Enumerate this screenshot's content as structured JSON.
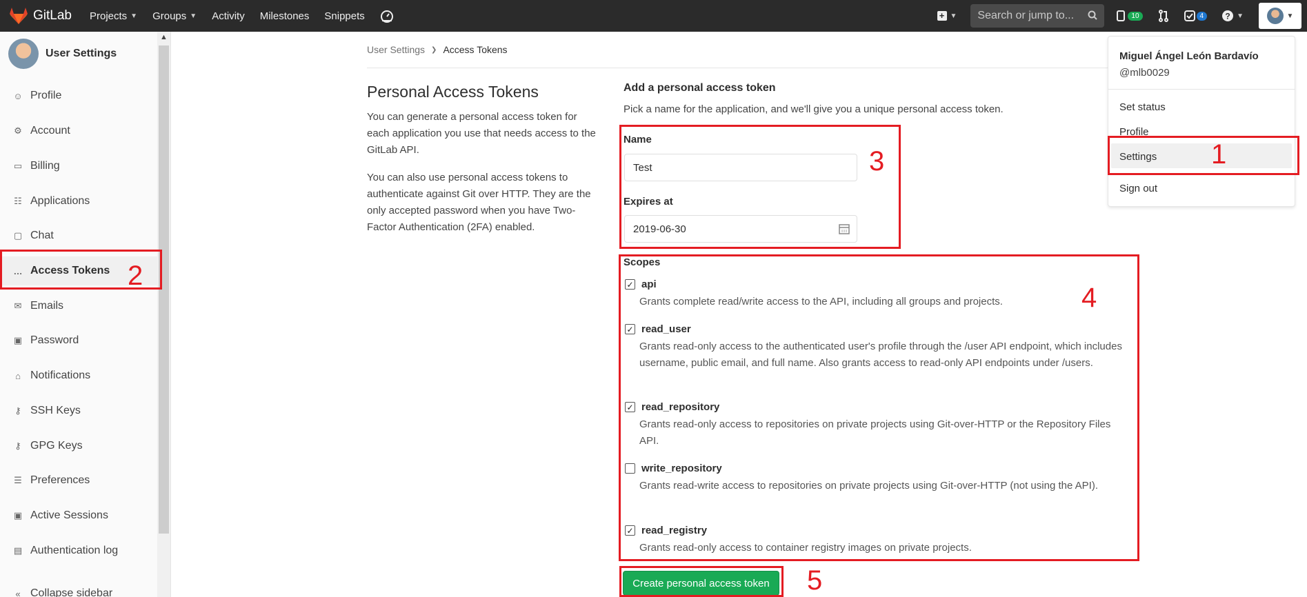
{
  "navbar": {
    "brand": "GitLab",
    "links": [
      {
        "label": "Projects",
        "caret": true
      },
      {
        "label": "Groups",
        "caret": true
      },
      {
        "label": "Activity",
        "caret": false
      },
      {
        "label": "Milestones",
        "caret": false
      },
      {
        "label": "Snippets",
        "caret": false
      }
    ],
    "search_placeholder": "Search or jump to...",
    "issues_count": "10",
    "todos_count": "4"
  },
  "sidebar": {
    "title": "User Settings",
    "items": [
      {
        "label": "Profile",
        "icon": "user-circle-icon",
        "glyph": "☺"
      },
      {
        "label": "Account",
        "icon": "account-icon",
        "glyph": "⚙"
      },
      {
        "label": "Billing",
        "icon": "credit-card-icon",
        "glyph": "▭"
      },
      {
        "label": "Applications",
        "icon": "apps-grid-icon",
        "glyph": "☷"
      },
      {
        "label": "Chat",
        "icon": "comment-icon",
        "glyph": "▢"
      },
      {
        "label": "Access Tokens",
        "icon": "token-icon",
        "glyph": "…",
        "active": true
      },
      {
        "label": "Emails",
        "icon": "envelope-icon",
        "glyph": "✉"
      },
      {
        "label": "Password",
        "icon": "lock-icon",
        "glyph": "▣"
      },
      {
        "label": "Notifications",
        "icon": "bell-icon",
        "glyph": "⌂"
      },
      {
        "label": "SSH Keys",
        "icon": "key-icon",
        "glyph": "⚷"
      },
      {
        "label": "GPG Keys",
        "icon": "gpg-key-icon",
        "glyph": "⚷"
      },
      {
        "label": "Preferences",
        "icon": "sliders-icon",
        "glyph": "☰"
      },
      {
        "label": "Active Sessions",
        "icon": "monitor-icon",
        "glyph": "▣"
      },
      {
        "label": "Authentication log",
        "icon": "list-icon",
        "glyph": "▤"
      },
      {
        "label": "Collapse sidebar",
        "icon": "collapse-icon",
        "glyph": "«"
      }
    ]
  },
  "breadcrumb": {
    "parent": "User Settings",
    "current": "Access Tokens"
  },
  "intro": {
    "title": "Personal Access Tokens",
    "para1": "You can generate a personal access token for each application you use that needs access to the GitLab API.",
    "para2": "You can also use personal access tokens to authenticate against Git over HTTP. They are the only accepted password when you have Two-Factor Authentication (2FA) enabled."
  },
  "form": {
    "title": "Add a personal access token",
    "subtitle": "Pick a name for the application, and we'll give you a unique personal access token.",
    "name_label": "Name",
    "name_value": "Test",
    "expires_label": "Expires at",
    "expires_value": "2019-06-30",
    "scopes_label": "Scopes",
    "scopes": [
      {
        "name": "api",
        "checked": true,
        "desc": "Grants complete read/write access to the API, including all groups and projects."
      },
      {
        "name": "read_user",
        "checked": true,
        "desc": "Grants read-only access to the authenticated user's profile through the /user API endpoint, which includes username, public email, and full name. Also grants access to read-only API endpoints under /users."
      },
      {
        "name": "read_repository",
        "checked": true,
        "desc": "Grants read-only access to repositories on private projects using Git-over-HTTP or the Repository Files API."
      },
      {
        "name": "write_repository",
        "checked": false,
        "desc": "Grants read-write access to repositories on private projects using Git-over-HTTP (not using the API)."
      },
      {
        "name": "read_registry",
        "checked": true,
        "desc": "Grants read-only access to container registry images on private projects."
      }
    ],
    "create_button": "Create personal access token"
  },
  "user_dropdown": {
    "name": "Miguel Ángel León Bardavío",
    "handle": "@mlb0029",
    "items": [
      "Set status",
      "Profile",
      "Settings",
      "Sign out"
    ]
  },
  "annotations": [
    "1",
    "2",
    "3",
    "4",
    "5"
  ],
  "colors": {
    "navbar": "#2b2b2b",
    "accent_green": "#1aaa55",
    "annotation_red": "#e41c22"
  }
}
